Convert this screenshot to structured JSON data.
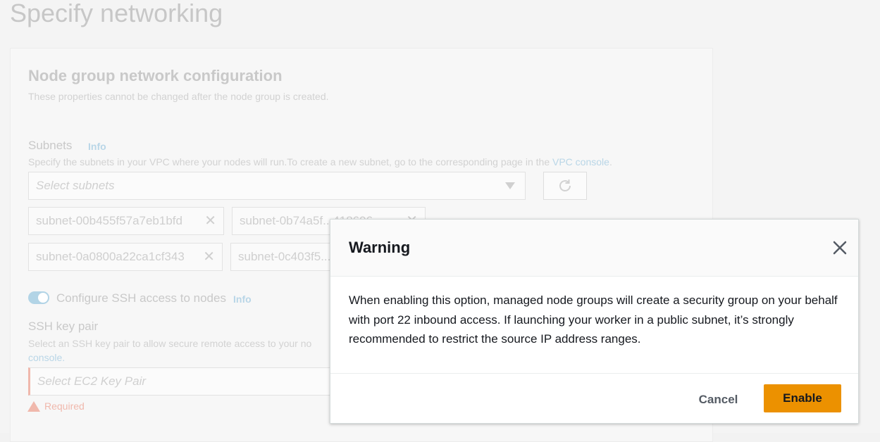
{
  "page": {
    "title": "Specify networking"
  },
  "network_config": {
    "title": "Node group network configuration",
    "description": "These properties cannot be changed after the node group is created.",
    "subnets": {
      "label": "Subnets",
      "info": "Info",
      "description": "Specify the subnets in your VPC where your nodes will run.To create a new subnet, go to the corresponding page in the",
      "link": "VPC console",
      "link_suffix": ".",
      "placeholder": "Select subnets",
      "tokens": [
        "subnet-00b455f57a7eb1bfd",
        "subnet-0b74a5f...418696",
        "subnet-0a0800a22ca1cf343",
        "subnet-0c403f5..."
      ]
    },
    "ssh": {
      "toggle_label": "Configure SSH access to nodes",
      "info": "Info",
      "keypair_label": "SSH key pair",
      "keypair_description": "Select an SSH key pair to allow secure remote access to your no",
      "keypair_link": "console.",
      "keypair_placeholder": "Select EC2 Key Pair",
      "required_text": "Required"
    }
  },
  "modal": {
    "title": "Warning",
    "body": "When enabling this option, managed node groups will create a security group on your behalf with port 22 inbound access. If launching your worker in a public subnet, it’s strongly recommended to restrict the source IP address ranges.",
    "cancel_label": "Cancel",
    "enable_label": "Enable"
  },
  "colors": {
    "primary_button": "#ec9100",
    "link": "#0073bb",
    "error": "#d13212"
  }
}
